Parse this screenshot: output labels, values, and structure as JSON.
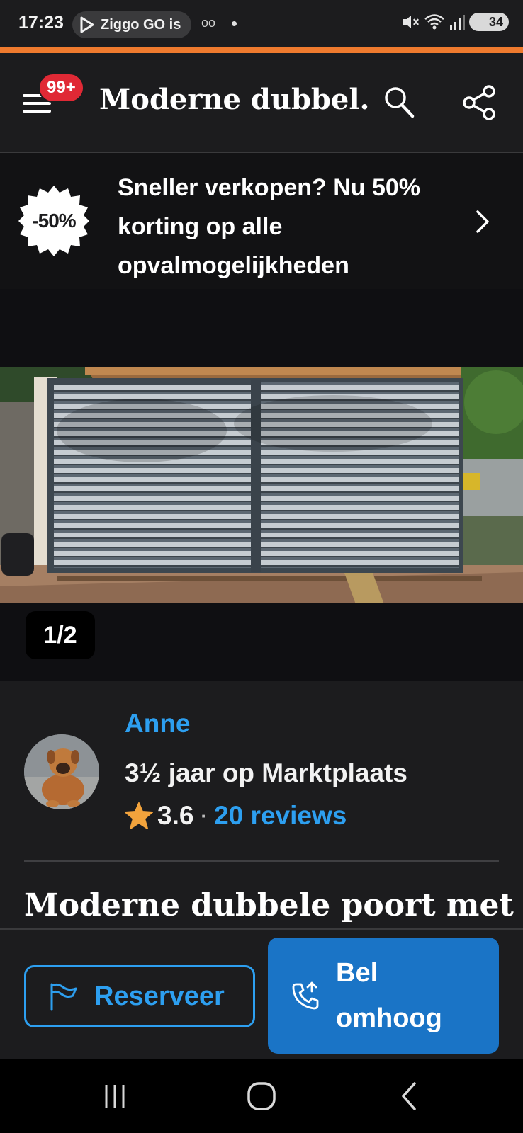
{
  "status_bar": {
    "time": "17:23",
    "notification_app": "Ziggo GO is",
    "voicemail_glyph": "oo",
    "battery": "34"
  },
  "header": {
    "menu_badge": "99+",
    "title": "Moderne dubbel..."
  },
  "promo": {
    "badge": "-50%",
    "text": "Sneller verkopen? Nu 50% korting op alle opvalmogelijkheden"
  },
  "gallery": {
    "counter": "1/2",
    "current": 1,
    "total": 2
  },
  "seller": {
    "name": "Anne",
    "since": "3½ jaar op Marktplaats",
    "rating": "3.6",
    "separator": "·",
    "reviews": "20 reviews"
  },
  "listing": {
    "title": "Moderne dubbele poort met"
  },
  "actions": {
    "reserve_label": "Reserveer",
    "call_label": "Bel omhoog"
  },
  "colors": {
    "accent_orange": "#ee7a2e",
    "link_blue": "#2d9ff0",
    "primary_button": "#1a74c6",
    "badge_red": "#e02935",
    "star": "#f2a33c",
    "background": "#1c1c1e"
  },
  "icons": {
    "menu": "hamburger-icon",
    "search": "search-icon",
    "share": "share-icon",
    "chevron": "chevron-right-icon",
    "flag": "flag-icon",
    "phone": "phone-outgoing-icon",
    "star": "star-icon",
    "recent_apps": "recent-apps-icon",
    "home": "home-icon",
    "back": "back-icon"
  }
}
